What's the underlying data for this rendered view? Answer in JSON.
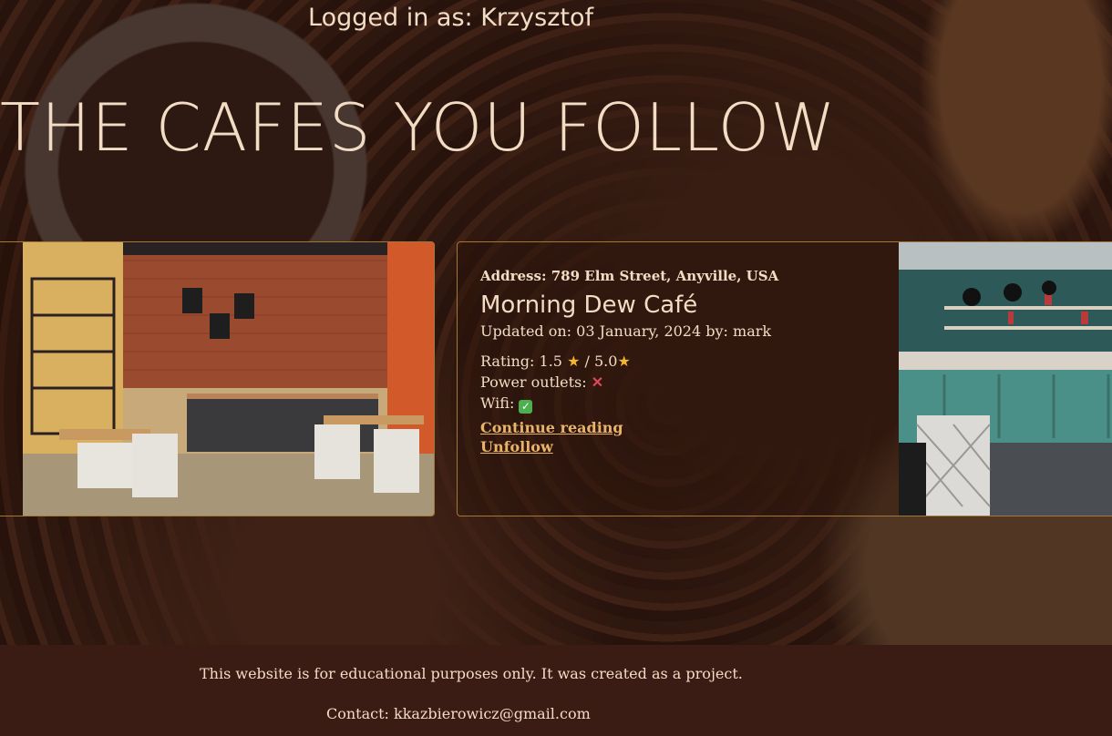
{
  "header": {
    "login_prefix": "Logged in as:",
    "username": "Krzysztof"
  },
  "page_title": "THE CAFES YOU FOLLOW",
  "cafes": [
    {
      "address_label": "Address:",
      "address": "789 Elm Street, Anyville, USA",
      "name": "Morning Dew Café",
      "updated_prefix": "Updated on:",
      "updated_date": "03 January, 2024",
      "updated_by_prefix": "by:",
      "updated_by": "mark",
      "rating_label": "Rating:",
      "rating": "1.5",
      "rating_separator": "/",
      "rating_max": "5.0",
      "power_label": "Power outlets:",
      "power_icon": "cross-mark-icon",
      "wifi_label": "Wifi:",
      "wifi_icon": "check-mark-icon",
      "continue_label": "Continue reading",
      "unfollow_label": "Unfollow"
    }
  ],
  "footer": {
    "disclaimer": "This website is for educational purposes only. It was created as a project.",
    "contact_label": "Contact:",
    "contact_email": "kkazbierowicz@gmail.com"
  },
  "colors": {
    "accent": "#e9b46a",
    "text": "#f3dcc4",
    "footer_bg": "#3a1c14",
    "card_border": "#a0783a"
  }
}
